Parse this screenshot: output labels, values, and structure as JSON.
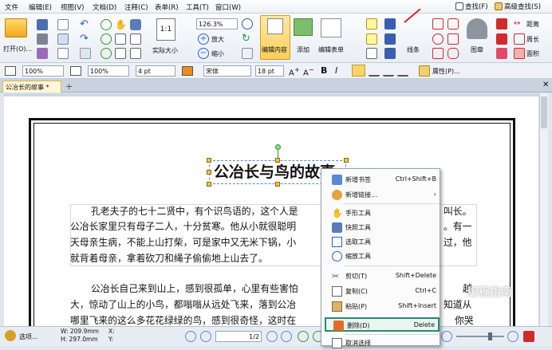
{
  "menu": {
    "items": [
      "文件",
      "编辑(E)",
      "视图(V)",
      "文档(D)",
      "注释(C)",
      "表单(R)",
      "工具(T)",
      "窗口(W)"
    ],
    "find": "查找(F)",
    "advanced_find": "高级查找(S)"
  },
  "ribbon": {
    "open": "打开(O)...",
    "zoom_value": "126.3%",
    "zoom_in": "放大",
    "zoom_out": "缩小",
    "actual_size": "实际大小",
    "edit_content": "编辑内容",
    "add": "添加",
    "edit_form": "编辑表单",
    "lines": "线条",
    "stamp": "图章",
    "distance": "距离",
    "perimeter": "周长",
    "area": "面积"
  },
  "format": {
    "fill_pct": "100%",
    "stroke_pct": "100%",
    "line_width": "4 pt",
    "font": "宋体",
    "font_size": "18 pt",
    "bold": "B",
    "italic": "I",
    "properties": "属性(P)..."
  },
  "tab": {
    "name": "公冶长的故事 *",
    "add": "+"
  },
  "document": {
    "title": "公冶长与鸟的故事",
    "p1": [
      "孔老夫子的七十二贤中，有个识鸟语的，这个人是",
      "叫长。",
      "公冶长家里只有母子二人，十分贫寒。他从小就很聪明",
      "。有一",
      "天母亲生病，不能上山打柴，可是家中又无米下锅，小",
      "过，他",
      "就背着母亲，拿着砍刀和绳子偷偷地上山去了。"
    ],
    "p2": [
      "公冶长自己来到山上，感到很孤单，心里有些害怕",
      "越",
      "大，惊动了山上的小鸟，都嗡嗡从远处飞来，落到公冶",
      "知道从",
      "哪里飞来的这么多花花绿绿的鸟，感到很奇怪，这时在",
      "你哭"
    ]
  },
  "context_menu": [
    {
      "label": "新增书签",
      "key": "Ctrl+Shift+B",
      "icon": "bookmark-add-icon"
    },
    {
      "label": "新增链接...",
      "key": "",
      "icon": "link-add-icon"
    },
    {
      "label": "手形工具",
      "key": "",
      "icon": "hand-icon"
    },
    {
      "label": "快照工具",
      "key": "",
      "icon": "camera-icon"
    },
    {
      "label": "选取工具",
      "key": "",
      "icon": "select-text-icon"
    },
    {
      "label": "缩放工具",
      "key": "",
      "icon": "zoom-icon"
    },
    {
      "label": "剪切(T)",
      "key": "Shift+Delete",
      "icon": "scissors-icon"
    },
    {
      "label": "复制(C)",
      "key": "Ctrl+C",
      "icon": "copy-icon"
    },
    {
      "label": "粘贴(P)",
      "key": "Shift+Insert",
      "icon": "paste-icon"
    },
    {
      "label": "删除(D)",
      "key": "Delete",
      "icon": "delete-icon"
    },
    {
      "label": "取消选择",
      "key": "",
      "icon": "deselect-icon"
    }
  ],
  "status": {
    "select": "选项...",
    "w": "W: 209.9mm",
    "h": "H: 297.0mm",
    "x": "X:",
    "y": "Y:",
    "page": "1/2"
  },
  "watermark": {
    "text": "编程指南"
  },
  "colors": {
    "accent": "#f6c344",
    "highlight": "#2a8a6e",
    "menu_text": "#111111"
  }
}
